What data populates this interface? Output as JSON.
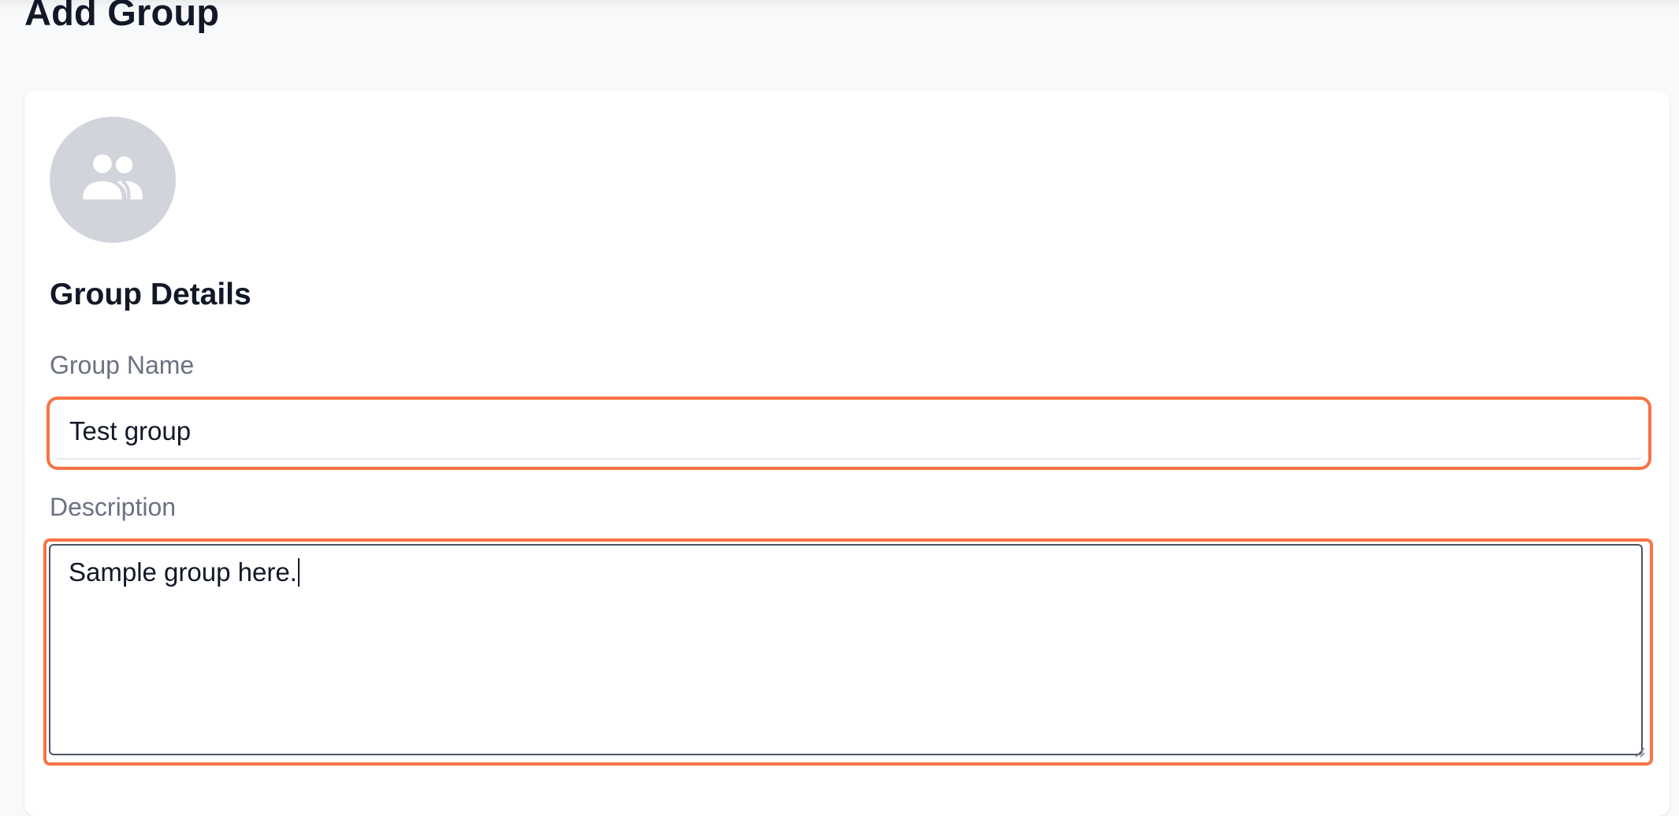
{
  "header": {
    "title": "Add Group"
  },
  "avatar": {
    "icon": "group-icon",
    "bg_color": "#d1d5db"
  },
  "section": {
    "title": "Group Details"
  },
  "form": {
    "group_name": {
      "label": "Group Name",
      "value": "Test group"
    },
    "description": {
      "label": "Description",
      "value": "Sample group here."
    }
  },
  "colors": {
    "focus_ring": "#f97345",
    "label": "#6b7280",
    "heading": "#111827"
  }
}
